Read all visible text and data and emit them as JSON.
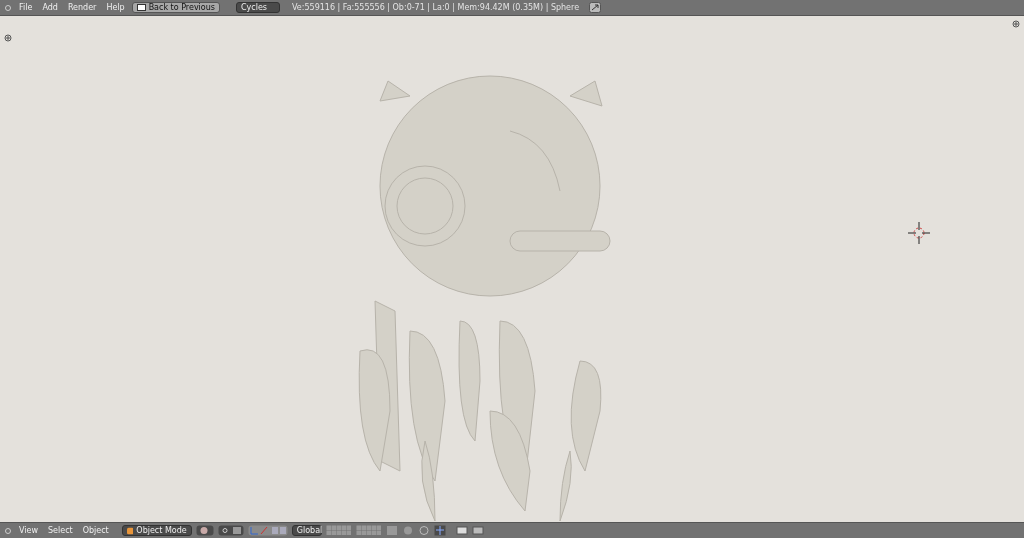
{
  "top_bar": {
    "menus": [
      "File",
      "Add",
      "Render",
      "Help"
    ],
    "back_button": "Back to Previous",
    "render_engine": "Cycles",
    "stats": "Ve:559116 | Fa:555556 | Ob:0-71 | La:0 | Mem:94.42M (0.35M) | Sphere"
  },
  "bottom_bar": {
    "menus": [
      "View",
      "Select",
      "Object"
    ],
    "mode": "Object Mode",
    "orientation": "Global"
  }
}
